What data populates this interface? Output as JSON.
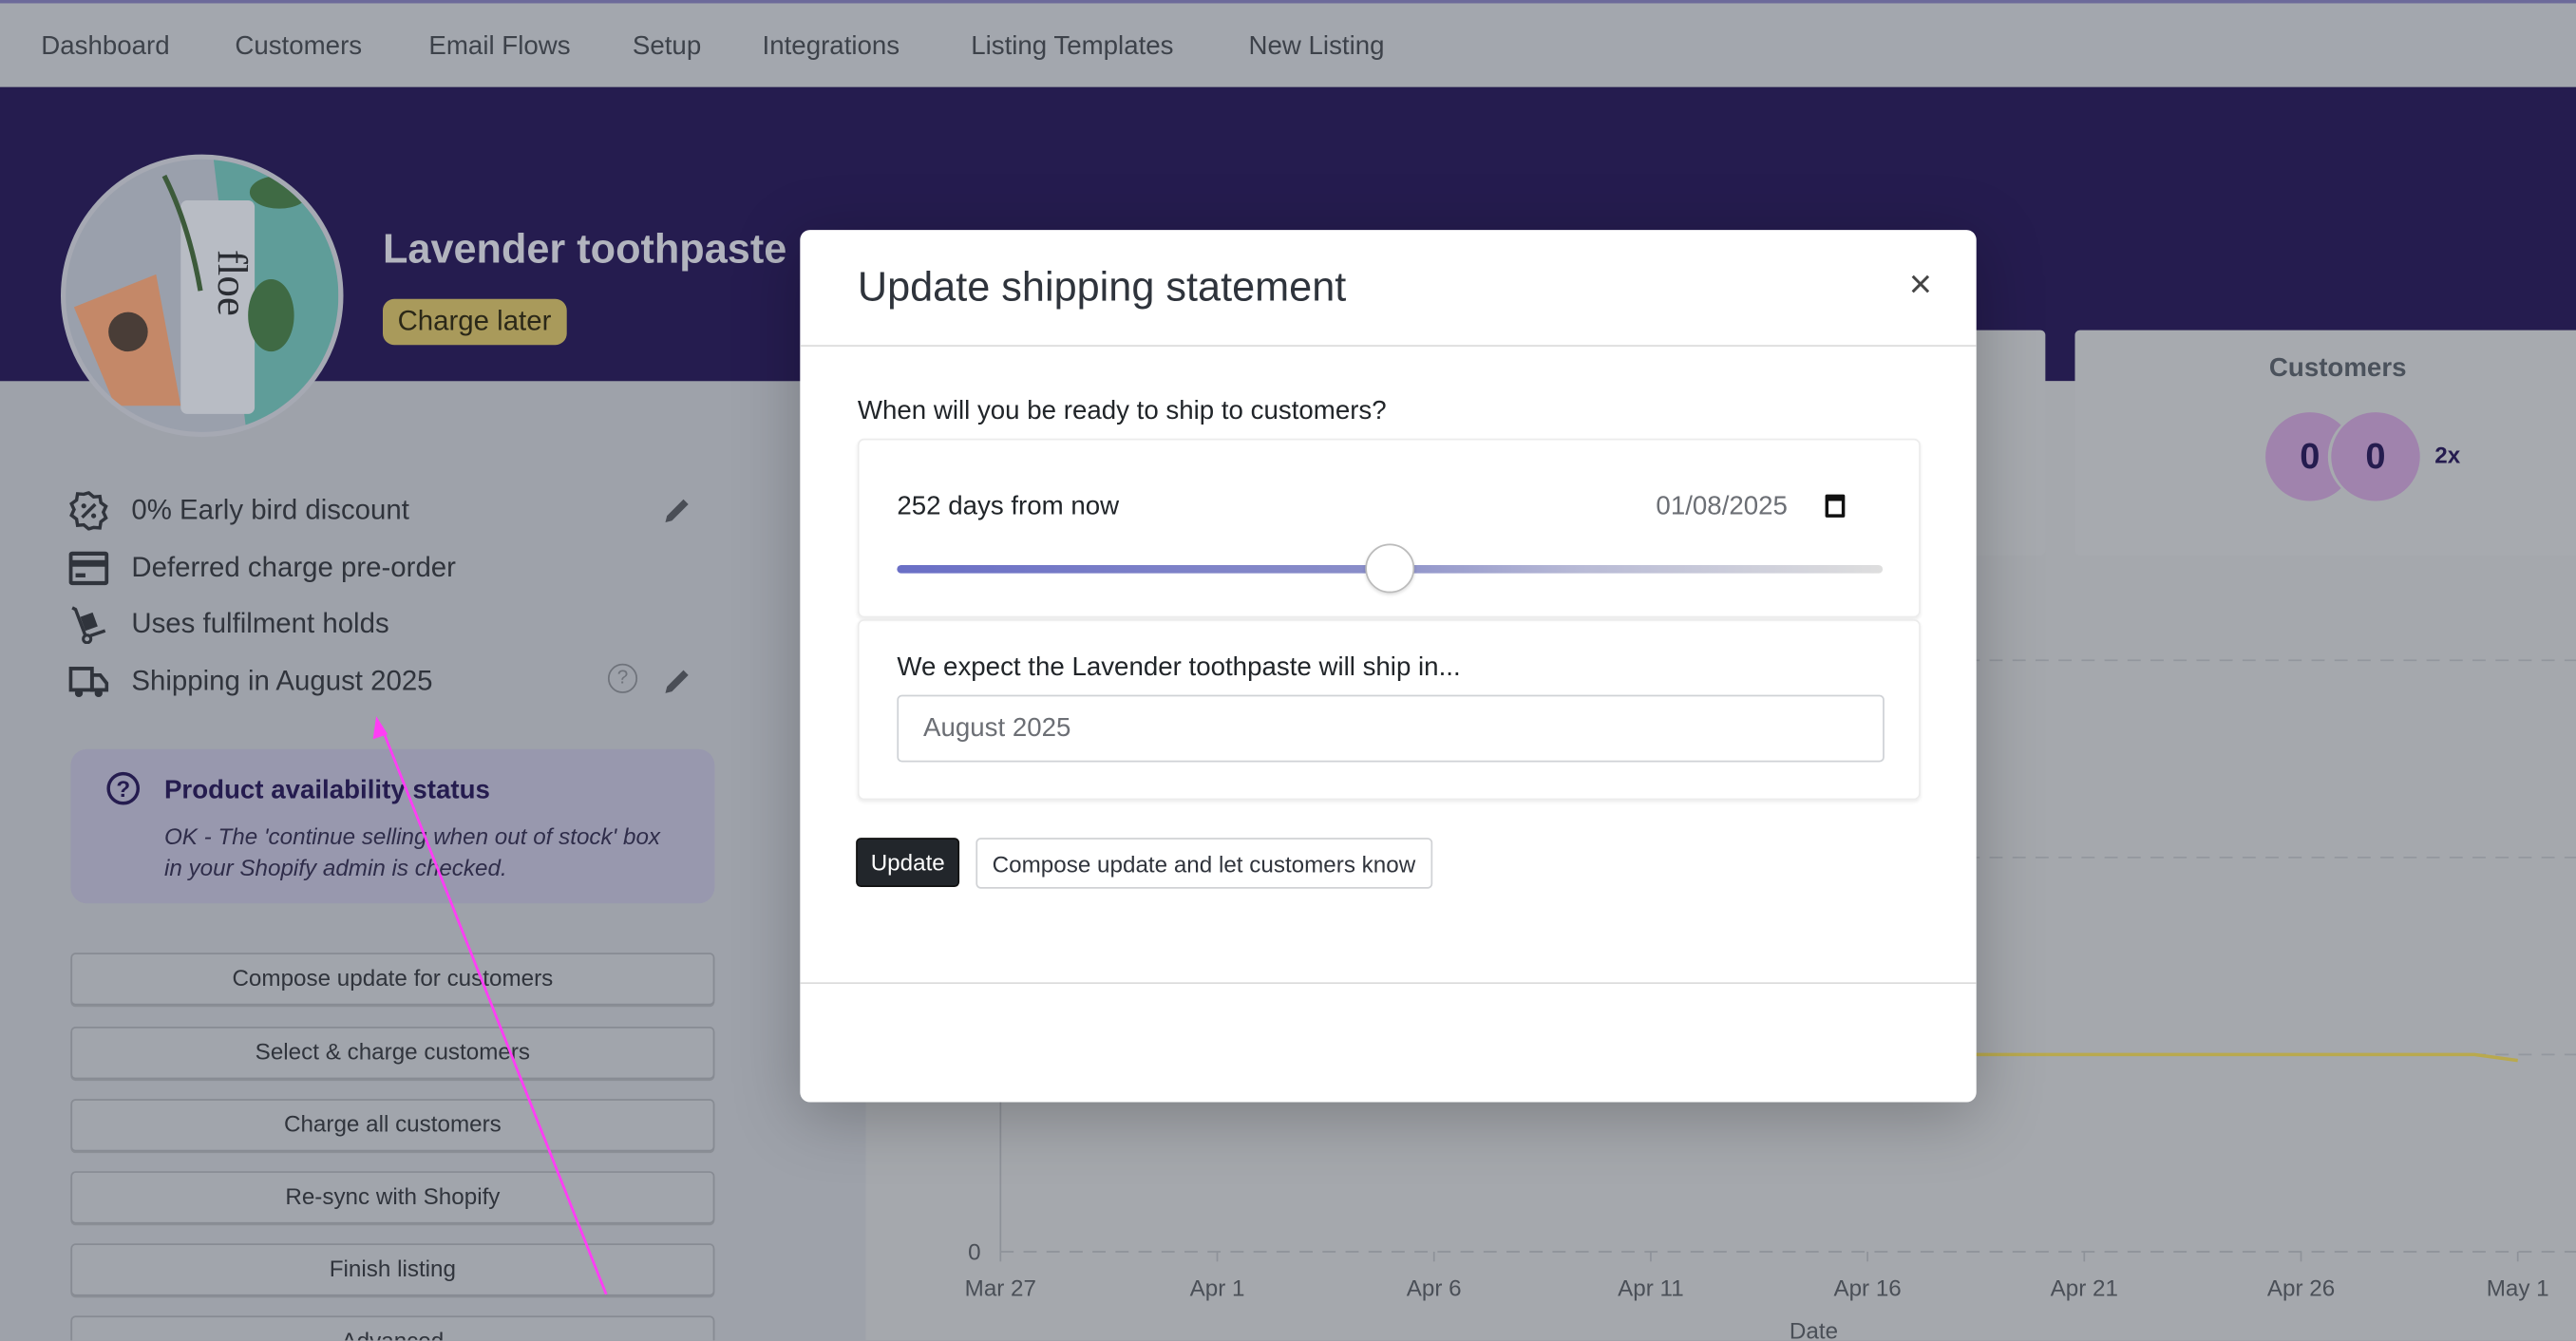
{
  "nav": {
    "items": [
      "Dashboard",
      "Customers",
      "Email Flows",
      "Setup",
      "Integrations",
      "Listing Templates",
      "New Listing"
    ]
  },
  "product": {
    "title": "Lavender toothpaste",
    "badge": "Charge later",
    "image_text": "floe",
    "features": [
      {
        "icon": "discount-badge-icon",
        "label": "0% Early bird discount",
        "editable": true
      },
      {
        "icon": "credit-card-icon",
        "label": "Deferred charge pre-order",
        "editable": false
      },
      {
        "icon": "hand-truck-icon",
        "label": "Uses fulfilment holds",
        "editable": false
      },
      {
        "icon": "truck-icon",
        "label": "Shipping in August 2025",
        "editable": true,
        "help": "?"
      }
    ]
  },
  "availability": {
    "icon": "question-circle-icon",
    "icon_glyph": "?",
    "heading": "Product availability status",
    "body": "OK - The 'continue selling when out of stock' box in your Shopify admin is checked."
  },
  "actions": [
    "Compose update for customers",
    "Select & charge customers",
    "Charge all customers",
    "Re-sync with Shopify",
    "Finish listing",
    "Advanced"
  ],
  "customers_card": {
    "title": "Customers",
    "bubbles": [
      "0",
      "0"
    ],
    "multiplier": "2x",
    "bubble_color": "#a083ad"
  },
  "chart_data": {
    "type": "line",
    "xlabel": "Date",
    "x_ticks": [
      "Mar 27",
      "Apr 1",
      "Apr 6",
      "Apr 11",
      "Apr 16",
      "Apr 21",
      "Apr 26",
      "May 1"
    ],
    "y_ticks": [
      "0"
    ],
    "grid": "dashed horizontal",
    "series": [
      {
        "color": "#b9a94e",
        "x": [
          "Mar 27",
          "Apr 11",
          "Apr 26",
          "Apr 30",
          "May 1"
        ],
        "y": [
          1,
          1,
          1,
          1,
          0.97
        ]
      }
    ],
    "ylim": [
      0,
      3
    ]
  },
  "modal": {
    "title": "Update shipping statement",
    "close": "×",
    "question": "When will you be ready to ship to customers?",
    "days_label": "252 days from now",
    "date_value": "01/08/2025",
    "slider_percent": 50,
    "expect_label": "We expect the Lavender toothpaste will ship in...",
    "ship_value": "August 2025",
    "update_button": "Update",
    "compose_button": "Compose update and let customers know"
  },
  "colors": {
    "hero": "#251c4f",
    "annotation": "#ff3df5",
    "accent": "#6a6fc6"
  }
}
